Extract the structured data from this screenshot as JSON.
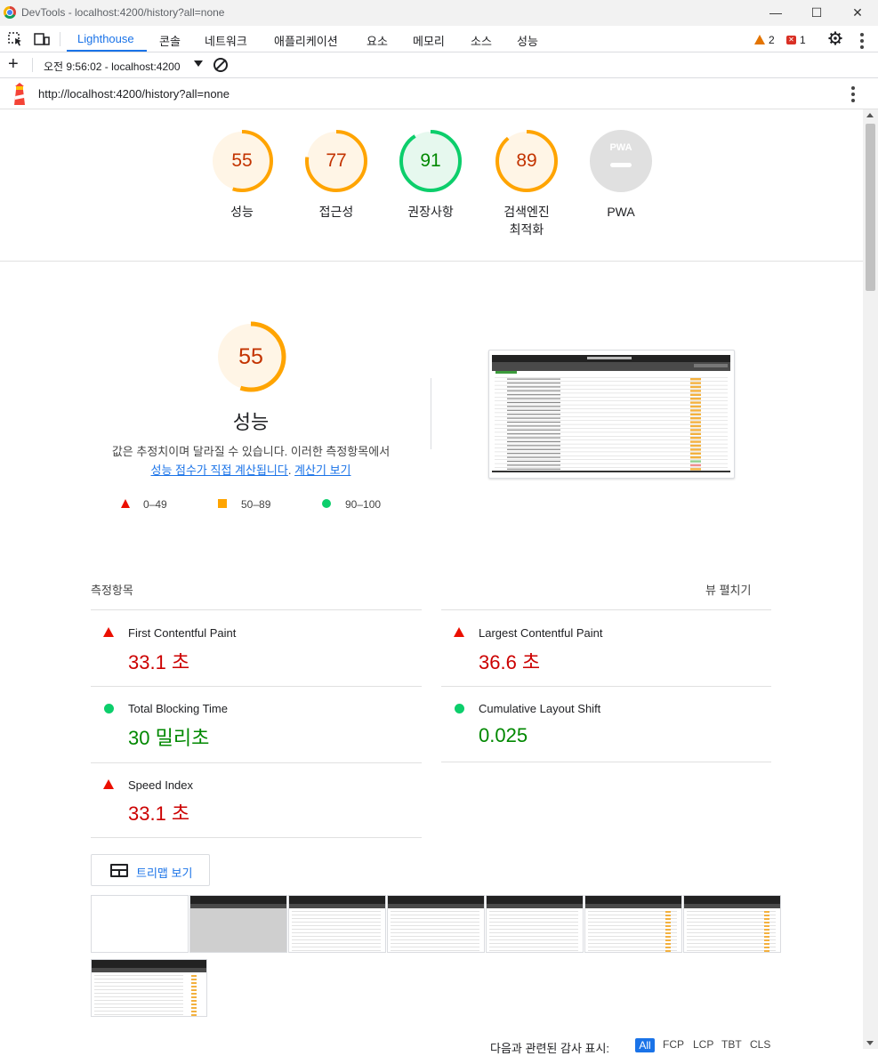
{
  "window": {
    "title": "DevTools - localhost:4200/history?all=none"
  },
  "devtools": {
    "tabs": [
      {
        "label": "Lighthouse"
      },
      {
        "label": "콘솔"
      },
      {
        "label": "네트워크"
      },
      {
        "label": "애플리케이션"
      },
      {
        "label": "요소"
      },
      {
        "label": "메모리"
      },
      {
        "label": "소스"
      },
      {
        "label": "성능"
      }
    ],
    "warnings_count": "2",
    "errors_count": "1"
  },
  "lighthouse_bar": {
    "report_label": "오전 9:56:02 - localhost:4200"
  },
  "url": "http://localhost:4200/history?all=none",
  "gauges": [
    {
      "label": "성능",
      "score": "55",
      "color": "#ffa400",
      "fraction": 0.55
    },
    {
      "label": "접근성",
      "score": "77",
      "color": "#ffa400",
      "fraction": 0.77
    },
    {
      "label": "권장사항",
      "score": "91",
      "color": "#0cce6b",
      "fraction": 0.91
    },
    {
      "label": "검색엔진\n최적화",
      "score": "89",
      "color": "#ffa400",
      "fraction": 0.89
    },
    {
      "label": "PWA",
      "score": "",
      "color": "#cccccc"
    }
  ],
  "category": {
    "title": "성능",
    "score": "55",
    "fraction": 0.55,
    "description": "값은 추정치이며 달라질 수 있습니다. 이러한 측정항목에서",
    "link1": "성능 점수가 직접 계산됩니다",
    "link2": "계산기 보기",
    "legend": [
      {
        "range": "0–49",
        "color": "#eb0f00"
      },
      {
        "range": "50–89",
        "color": "#ffa400"
      },
      {
        "range": "90–100",
        "color": "#0cce6b"
      }
    ]
  },
  "metrics": {
    "header": "측정항목",
    "expand_label": "뷰 펼치기",
    "items": [
      {
        "name": "First Contentful Paint",
        "value": "33.1 초",
        "status": "fail"
      },
      {
        "name": "Largest Contentful Paint",
        "value": "36.6 초",
        "status": "fail"
      },
      {
        "name": "Total Blocking Time",
        "value": "30 밀리초",
        "status": "pass"
      },
      {
        "name": "Cumulative Layout Shift",
        "value": "0.025",
        "status": "pass"
      },
      {
        "name": "Speed Index",
        "value": "33.1 초",
        "status": "fail"
      }
    ]
  },
  "treemap_button": "트리맵 보기",
  "audit_filter": {
    "label": "다음과 관련된 감사 표시:",
    "chips": [
      "All",
      "FCP",
      "LCP",
      "TBT",
      "CLS"
    ]
  }
}
